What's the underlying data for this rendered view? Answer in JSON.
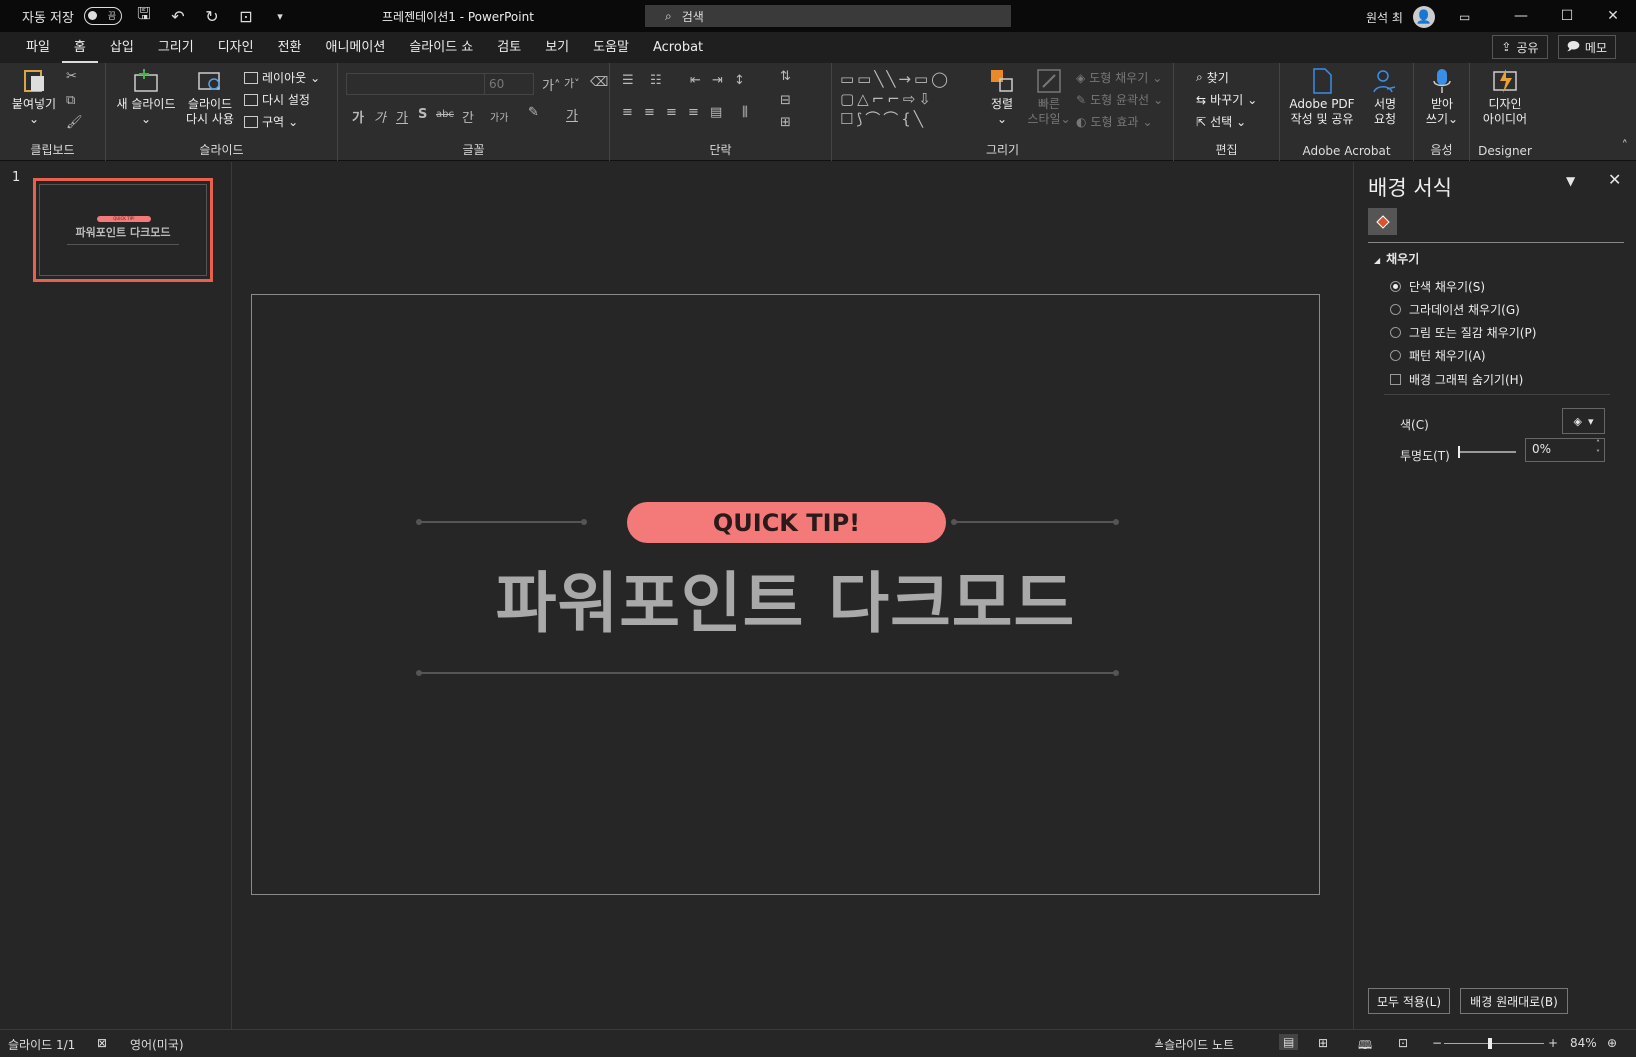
{
  "titlebar": {
    "autosave_label": "자동 저장",
    "autosave_state": "끔",
    "doc_title": "프레젠테이션1  -  PowerPoint",
    "search_placeholder": "검색",
    "user_name": "원석 최"
  },
  "menu": {
    "tabs": [
      "파일",
      "홈",
      "삽입",
      "그리기",
      "디자인",
      "전환",
      "애니메이션",
      "슬라이드 쇼",
      "검토",
      "보기",
      "도움말",
      "Acrobat"
    ],
    "active_tab": "홈",
    "share": "공유",
    "comment": "메모"
  },
  "ribbon": {
    "clipboard": {
      "paste": "붙여넣기",
      "label": "클립보드"
    },
    "slides": {
      "new_slide": "새 슬라이드",
      "reuse_1": "슬라이드",
      "reuse_2": "다시 사용",
      "layout": "레이아웃",
      "reset": "다시 설정",
      "section": "구역",
      "label": "슬라이드"
    },
    "font": {
      "size": "60",
      "label": "글꼴",
      "grow": "가",
      "shrink": "가",
      "bold": "가",
      "italic": "가",
      "underline": "가",
      "shadow": "S",
      "strike": "abc",
      "spacing": "간",
      "case": "가가",
      "color": "가"
    },
    "paragraph": {
      "label": "단락"
    },
    "drawing": {
      "arrange": "정렬",
      "quick_style_1": "빠른",
      "quick_style_2": "스타일",
      "fill": "도형 채우기",
      "outline": "도형 윤곽선",
      "effects": "도형 효과",
      "label": "그리기"
    },
    "editing": {
      "find": "찾기",
      "replace": "바꾸기",
      "select": "선택",
      "label": "편집"
    },
    "acrobat": {
      "create_1": "Adobe PDF",
      "create_2": "작성 및 공유",
      "sign_1": "서명",
      "sign_2": "요청",
      "label": "Adobe Acrobat"
    },
    "voice": {
      "dictate_1": "받아",
      "dictate_2": "쓰기",
      "label": "음성"
    },
    "designer": {
      "ideas_1": "디자인",
      "ideas_2": "아이디어",
      "label": "Designer"
    }
  },
  "thumbnails": [
    {
      "number": "1",
      "pill": "QUICK TIP!",
      "title": "파워포인트 다크모드"
    }
  ],
  "slide": {
    "pill_text": "QUICK TIP!",
    "title": "파워포인트 다크모드",
    "pill_color": "#f47a7a",
    "selection_color": "#e8614e"
  },
  "format_pane": {
    "title": "배경 서식",
    "section": "채우기",
    "options": [
      {
        "label": "단색 채우기(S)",
        "selected": true
      },
      {
        "label": "그라데이션 채우기(G)",
        "selected": false
      },
      {
        "label": "그림 또는 질감 채우기(P)",
        "selected": false
      },
      {
        "label": "패턴 채우기(A)",
        "selected": false
      }
    ],
    "hide_graphics": "배경 그래픽 숨기기(H)",
    "color_label": "색(C)",
    "transparency_label": "투명도(T)",
    "transparency_value": "0%",
    "apply_all": "모두 적용(L)",
    "reset_bg": "배경 원래대로(B)"
  },
  "status": {
    "slide_count": "슬라이드 1/1",
    "language": "영어(미국)",
    "notes": "슬라이드 노트",
    "zoom": "84%"
  }
}
